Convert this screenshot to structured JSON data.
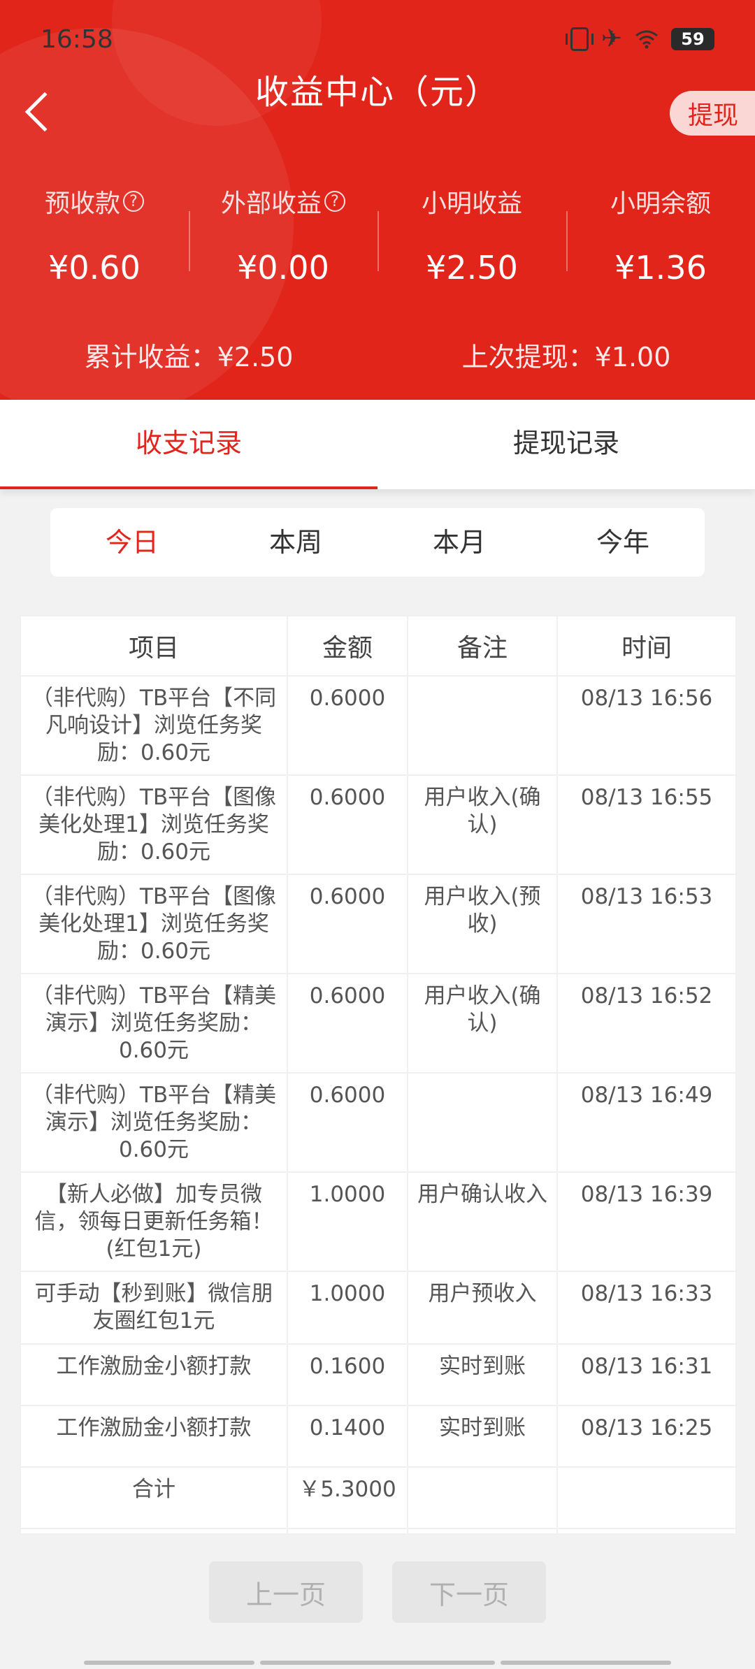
{
  "status": {
    "time": "16:58",
    "battery": "59"
  },
  "header": {
    "title": "收益中心（元）",
    "withdraw_label": "提现"
  },
  "stats": [
    {
      "label": "预收款",
      "help": true,
      "value": "¥0.60"
    },
    {
      "label": "外部收益",
      "help": true,
      "value": "¥0.00"
    },
    {
      "label": "小明收益",
      "help": false,
      "value": "¥2.50"
    },
    {
      "label": "小明余额",
      "help": false,
      "value": "¥1.36"
    }
  ],
  "summary": {
    "total_label": "累计收益：",
    "total_value": "¥2.50",
    "last_label": "上次提现：",
    "last_value": "¥1.00"
  },
  "tabs": [
    {
      "label": "收支记录",
      "active": true
    },
    {
      "label": "提现记录",
      "active": false
    }
  ],
  "periods": [
    {
      "label": "今日",
      "active": true
    },
    {
      "label": "本周",
      "active": false
    },
    {
      "label": "本月",
      "active": false
    },
    {
      "label": "今年",
      "active": false
    }
  ],
  "table": {
    "headers": [
      "项目",
      "金额",
      "备注",
      "时间"
    ],
    "rows": [
      {
        "item": "（非代购）TB平台【不同凡响设计】浏览任务奖励：0.60元",
        "amount": "0.6000",
        "note": "",
        "time": "08/13 16:56"
      },
      {
        "item": "（非代购）TB平台【图像美化处理1】浏览任务奖励：0.60元",
        "amount": "0.6000",
        "note": "用户收入(确认)",
        "time": "08/13 16:55"
      },
      {
        "item": "（非代购）TB平台【图像美化处理1】浏览任务奖励：0.60元",
        "amount": "0.6000",
        "note": "用户收入(预收)",
        "time": "08/13 16:53"
      },
      {
        "item": "（非代购）TB平台【精美演示】浏览任务奖励：0.60元",
        "amount": "0.6000",
        "note": "用户收入(确认)",
        "time": "08/13 16:52"
      },
      {
        "item": "（非代购）TB平台【精美演示】浏览任务奖励：0.60元",
        "amount": "0.6000",
        "note": "",
        "time": "08/13 16:49"
      },
      {
        "item": "【新人必做】加专员微信，领每日更新任务箱！(红包1元)",
        "amount": "1.0000",
        "note": "用户确认收入",
        "time": "08/13 16:39"
      },
      {
        "item": "可手动【秒到账】微信朋友圈红包1元",
        "amount": "1.0000",
        "note": "用户预收入",
        "time": "08/13 16:33"
      },
      {
        "item": "工作激励金小额打款",
        "amount": "0.1600",
        "note": "实时到账",
        "time": "08/13 16:31"
      },
      {
        "item": "工作激励金小额打款",
        "amount": "0.1400",
        "note": "实时到账",
        "time": "08/13 16:25"
      }
    ],
    "total_label": "合计",
    "total_value": "￥5.3000"
  },
  "pager": {
    "prev_label": "上一页",
    "next_label": "下一页"
  }
}
